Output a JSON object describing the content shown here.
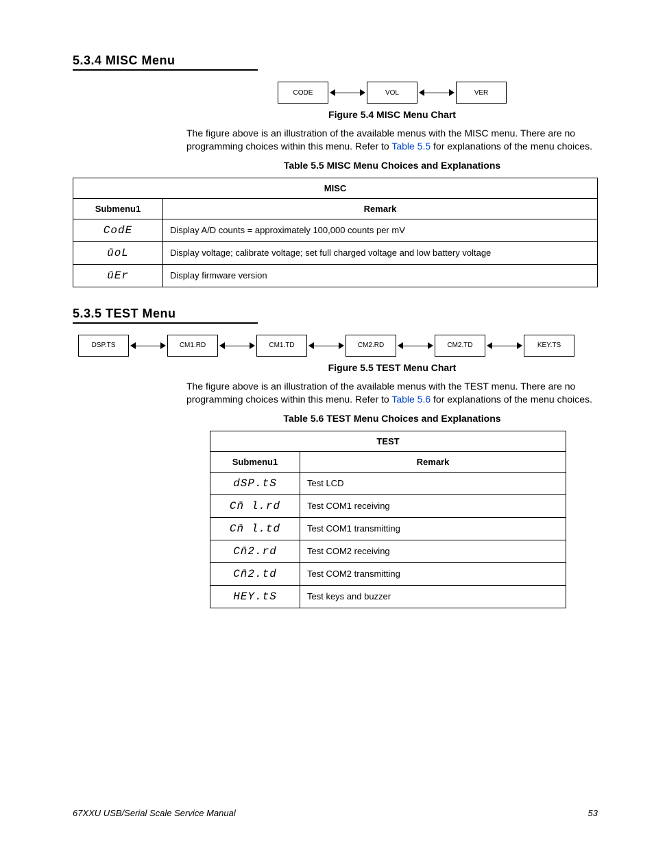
{
  "sections": {
    "misc": {
      "heading": "5.3.4  MISC Menu",
      "diagram_boxes": [
        "CODE",
        "VOL",
        "VER"
      ],
      "fig_caption": "Figure 5.4  MISC Menu Chart",
      "body_pre": "The figure above is an illustration of the available menus with the MISC menu. There are no programming choices within this menu. Refer to ",
      "body_link": "Table 5.5",
      "body_post": " for explanations of the menu choices.",
      "table_caption": "Table 5.5  MISC Menu Choices and Explanations",
      "table_header_top": "MISC",
      "col1": "Submenu1",
      "col2": "Remark",
      "rows": [
        {
          "seg": "CodE",
          "remark": "Display A/D counts = approximately 100,000 counts per mV"
        },
        {
          "seg": "ūoL",
          "remark": "Display voltage; calibrate voltage; set full charged voltage and low battery voltage"
        },
        {
          "seg": "ūEr",
          "remark": "Display firmware version"
        }
      ]
    },
    "test": {
      "heading": "5.3.5  TEST Menu",
      "diagram_boxes": [
        "DSP.TS",
        "CM1.RD",
        "CM1.TD",
        "CM2.RD",
        "CM2.TD",
        "KEY.TS"
      ],
      "fig_caption": "Figure 5.5  TEST Menu Chart",
      "body_pre": "The figure above is an illustration of the available menus with the TEST menu. There are no programming choices within this menu. Refer to ",
      "body_link": "Table 5.6",
      "body_post": " for explanations of the menu choices.",
      "table_caption": "Table 5.6  TEST Menu Choices and Explanations",
      "table_header_top": "TEST",
      "col1": "Submenu1",
      "col2": "Remark",
      "rows": [
        {
          "seg": "dSP.tS",
          "remark": "Test LCD"
        },
        {
          "seg": "Cn̄ l.rd",
          "remark": "Test COM1 receiving"
        },
        {
          "seg": "Cn̄ l.td",
          "remark": "Test COM1 transmitting"
        },
        {
          "seg": "Cn̄2.rd",
          "remark": "Test COM2 receiving"
        },
        {
          "seg": "Cn̄2.td",
          "remark": "Test COM2 transmitting"
        },
        {
          "seg": "HEY.tS",
          "remark": "Test keys and buzzer"
        }
      ]
    }
  },
  "footer": {
    "title": "67XXU USB/Serial Scale Service Manual",
    "page": "53"
  }
}
